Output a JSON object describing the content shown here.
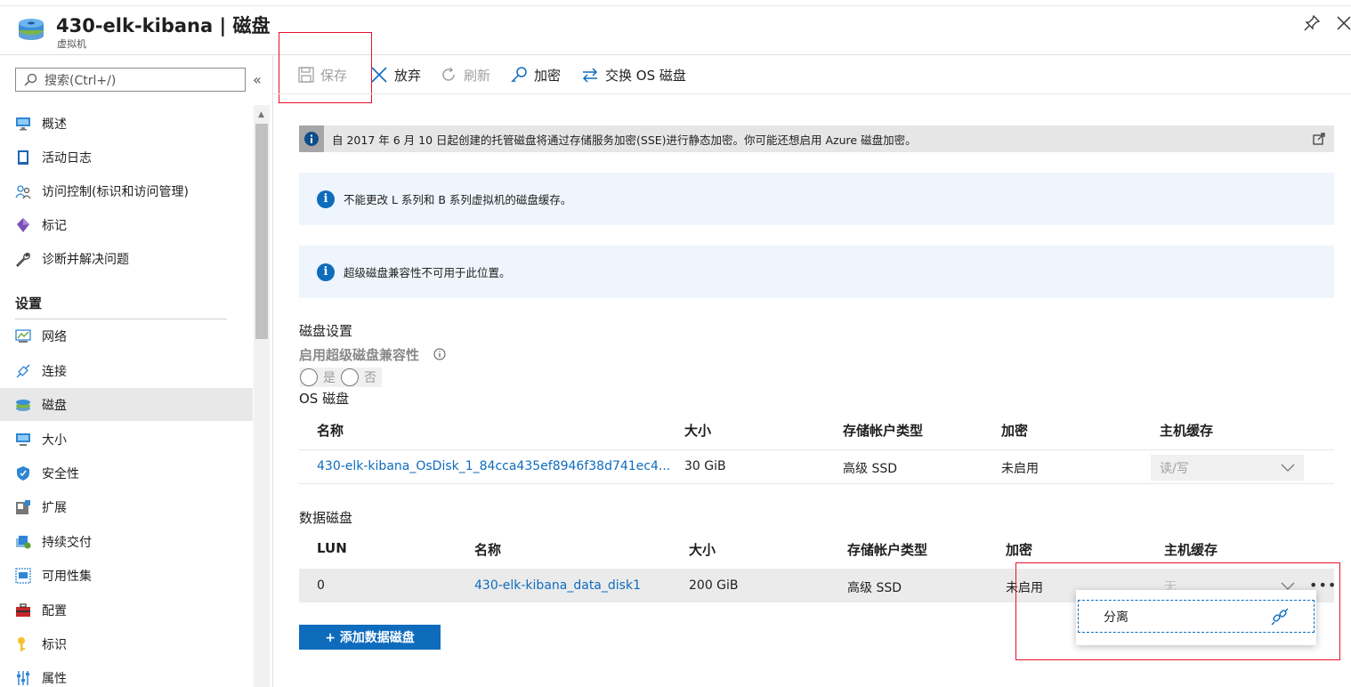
{
  "header": {
    "title": "430-elk-kibana | 磁盘",
    "subtitle": "虚拟机"
  },
  "sidebar": {
    "search_placeholder": "搜索(Ctrl+/)",
    "collapse_glyph": "«",
    "items": [
      {
        "label": "概述",
        "icon": "monitor-icon"
      },
      {
        "label": "活动日志",
        "icon": "log-icon"
      },
      {
        "label": "访问控制(标识和访问管理)",
        "icon": "people-icon"
      },
      {
        "label": "标记",
        "icon": "tag-icon"
      },
      {
        "label": "诊断并解决问题",
        "icon": "wrench-icon"
      }
    ],
    "settings_heading": "设置",
    "settings_items": [
      {
        "label": "网络",
        "icon": "network-icon"
      },
      {
        "label": "连接",
        "icon": "connect-icon"
      },
      {
        "label": "磁盘",
        "icon": "disk-icon",
        "active": true
      },
      {
        "label": "大小",
        "icon": "monitor-icon"
      },
      {
        "label": "安全性",
        "icon": "shield-icon"
      },
      {
        "label": "扩展",
        "icon": "extension-icon"
      },
      {
        "label": "持续交付",
        "icon": "delivery-icon"
      },
      {
        "label": "可用性集",
        "icon": "availability-icon"
      },
      {
        "label": "配置",
        "icon": "toolbox-icon"
      },
      {
        "label": "标识",
        "icon": "identity-icon"
      },
      {
        "label": "属性",
        "icon": "properties-icon"
      }
    ]
  },
  "toolbar": {
    "save": "保存",
    "discard": "放弃",
    "refresh": "刷新",
    "encrypt": "加密",
    "swap_os_disk": "交换 OS 磁盘"
  },
  "banners": {
    "sse": "自 2017 年 6 月 10 日起创建的托管磁盘将通过存储服务加密(SSE)进行静态加密。你可能还想启用 Azure 磁盘加密。",
    "cache": "不能更改 L 系列和 B 系列虚拟机的磁盘缓存。",
    "ultra": "超级磁盘兼容性不可用于此位置。"
  },
  "disk_settings": {
    "heading": "磁盘设置",
    "ultra_label": "启用超级磁盘兼容性",
    "yes": "是",
    "no": "否"
  },
  "os_disk": {
    "heading": "OS 磁盘",
    "columns": [
      "名称",
      "大小",
      "存储帐户类型",
      "加密",
      "主机缓存"
    ],
    "row": {
      "name": "430-elk-kibana_OsDisk_1_84cca435ef8946f38d741ec4...",
      "size": "30 GiB",
      "type": "高级 SSD",
      "encryption": "未启用",
      "cache": "读/写"
    }
  },
  "data_disks": {
    "heading": "数据磁盘",
    "columns": [
      "LUN",
      "名称",
      "大小",
      "存储帐户类型",
      "加密",
      "主机缓存"
    ],
    "row": {
      "lun": "0",
      "name": "430-elk-kibana_data_disk1",
      "size": "200 GiB",
      "type": "高级 SSD",
      "encryption": "未启用",
      "cache": "无"
    },
    "more": "•••",
    "add_button": "+ 添加数据磁盘"
  },
  "context_menu": {
    "detach": "分离"
  },
  "colors": {
    "accent": "#0f6cbd",
    "highlight_box": "#e8112d",
    "info_banner": "#eef5fd"
  }
}
